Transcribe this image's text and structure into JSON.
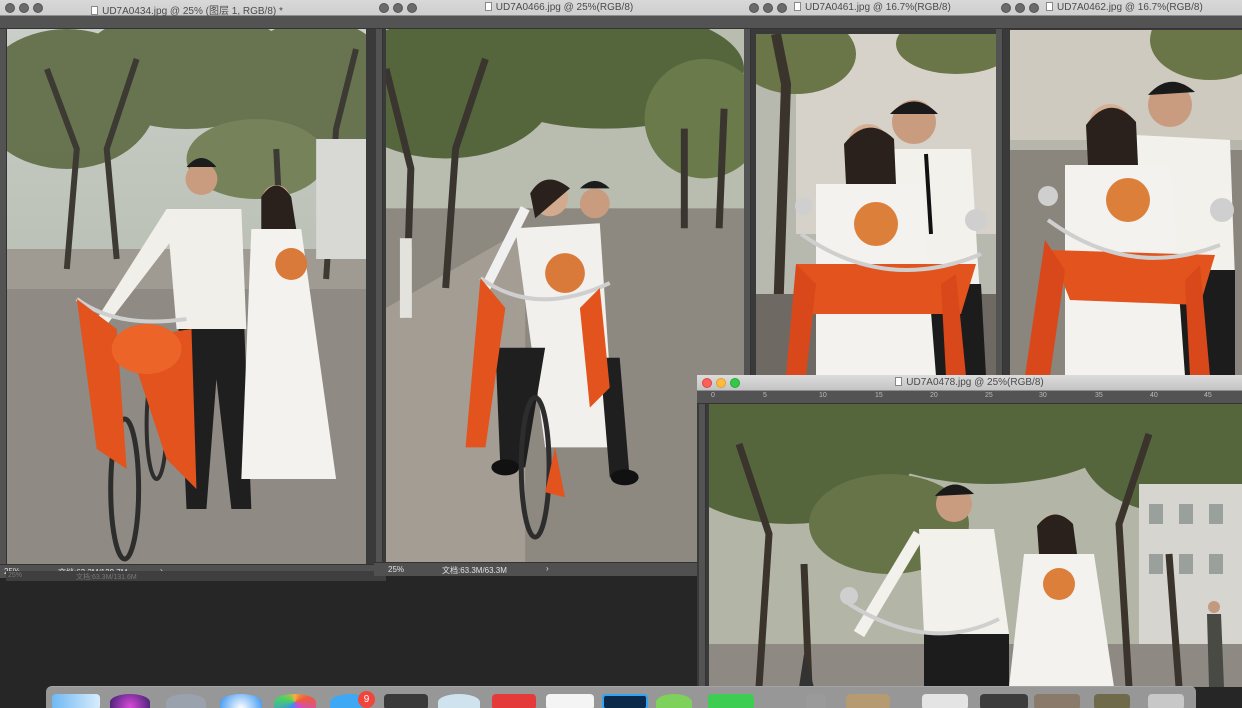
{
  "windows": [
    {
      "title": "UD7A0434.jpg @ 25% (图层 1, RGB/8) *",
      "zoom": "25%",
      "doc_size": "文档:63.3M/129.7M",
      "ruler_ticks": []
    },
    {
      "title": "UD7A0466.jpg @ 25%(RGB/8)",
      "zoom": "25%",
      "doc_size": "文档:63.3M/63.3M",
      "ruler_ticks": []
    },
    {
      "title": "UD7A0461.jpg @ 16.7%(RGB/8)",
      "zoom": "",
      "doc_size": "",
      "ruler_ticks": []
    },
    {
      "title": "UD7A0462.jpg @ 16.7%(RGB/8)",
      "zoom": "",
      "doc_size": "",
      "ruler_ticks": []
    },
    {
      "title": "UD7A0478.jpg @ 25%(RGB/8)",
      "zoom": "",
      "doc_size": "",
      "ruler_ticks": [
        "0",
        "5",
        "10",
        "15",
        "20",
        "25",
        "30",
        "35",
        "40",
        "45"
      ]
    }
  ],
  "hidden_status": {
    "zoom": "25%",
    "doc_size": "文档:63.3M/131.6M"
  },
  "dock": {
    "badges": [
      "9"
    ]
  },
  "colors": {
    "titlebar": "#d0d0d0",
    "ruler": "#535353",
    "statusbar": "#505050",
    "red_light": "#fc605c",
    "yellow_light": "#fdbc40",
    "green_light": "#34c84a",
    "ribbon_orange": "#e2531e",
    "tree_green": "#55663d"
  },
  "icons": [
    "close-icon",
    "minimize-icon",
    "zoom-icon",
    "document-icon",
    "chevron-right-icon",
    "photoshop-icon"
  ]
}
